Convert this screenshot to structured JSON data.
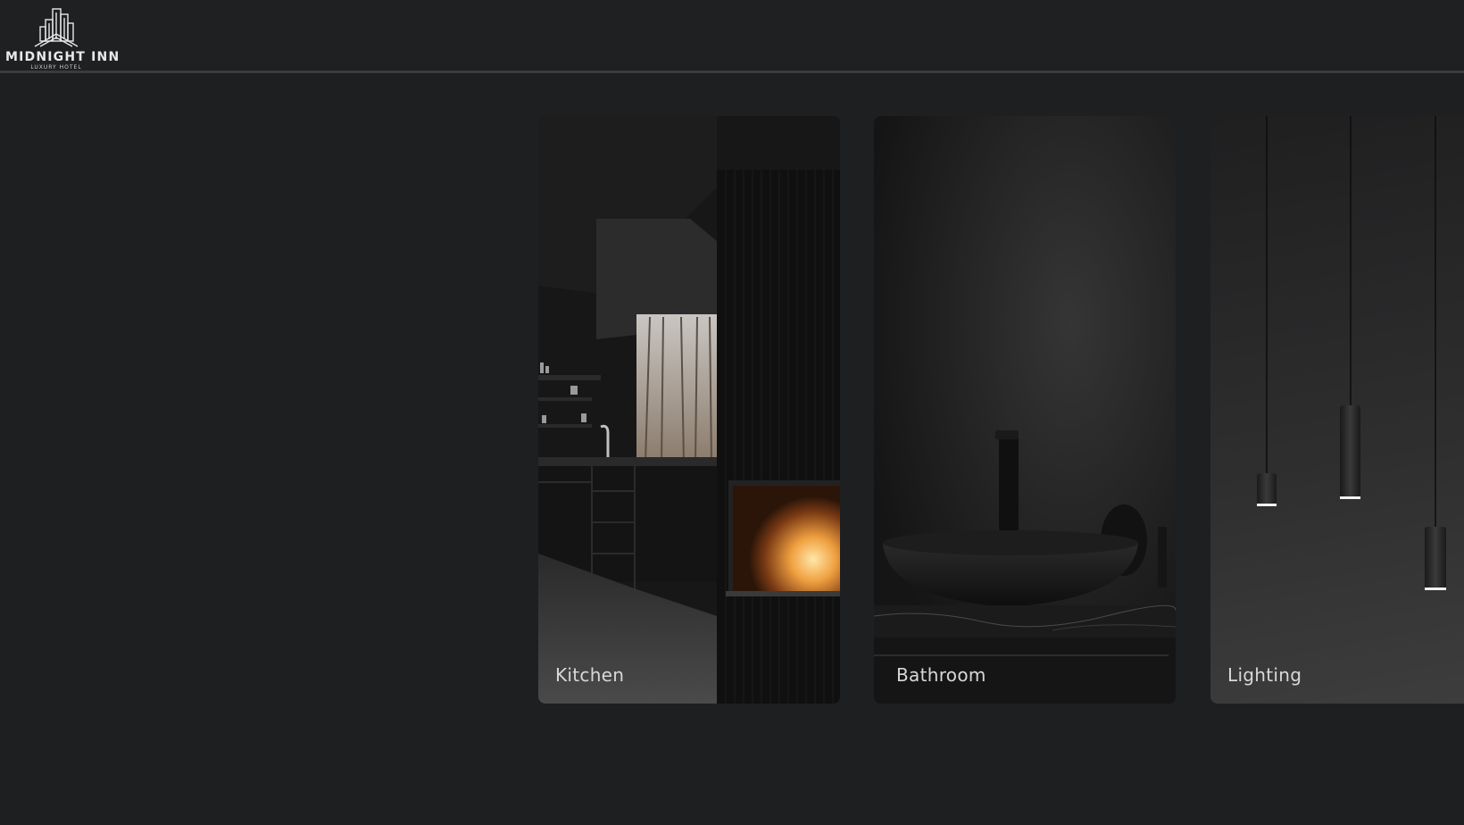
{
  "header": {
    "logo": {
      "icon": "city-buildings-logo-icon",
      "name": "MIDNIGHT INN",
      "tagline": "LUXURY HOTEL"
    }
  },
  "cards": [
    {
      "label": "Kitchen"
    },
    {
      "label": "Bathroom"
    },
    {
      "label": "Lighting"
    }
  ],
  "colors": {
    "background": "#1e1f21",
    "header_border": "#3a3b3d",
    "label_text": "#d8d8d8"
  }
}
